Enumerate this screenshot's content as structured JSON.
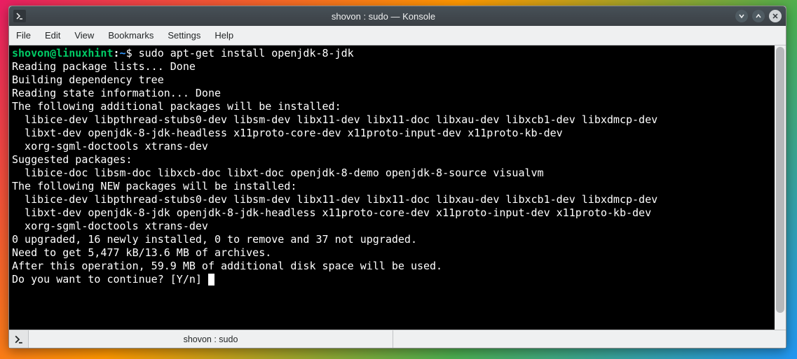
{
  "titlebar": {
    "title": "shovon : sudo — Konsole"
  },
  "menubar": {
    "file": "File",
    "edit": "Edit",
    "view": "View",
    "bookmarks": "Bookmarks",
    "settings": "Settings",
    "help": "Help"
  },
  "prompt": {
    "user_host": "shovon@linuxhint",
    "colon": ":",
    "path": "~",
    "dollar": "$",
    "command": " sudo apt-get install openjdk-8-jdk"
  },
  "output": {
    "l01": "Reading package lists... Done",
    "l02": "Building dependency tree       ",
    "l03": "Reading state information... Done",
    "l04": "The following additional packages will be installed:",
    "l05": "  libice-dev libpthread-stubs0-dev libsm-dev libx11-dev libx11-doc libxau-dev libxcb1-dev libxdmcp-dev",
    "l06": "  libxt-dev openjdk-8-jdk-headless x11proto-core-dev x11proto-input-dev x11proto-kb-dev",
    "l07": "  xorg-sgml-doctools xtrans-dev",
    "l08": "Suggested packages:",
    "l09": "  libice-doc libsm-doc libxcb-doc libxt-doc openjdk-8-demo openjdk-8-source visualvm",
    "l10": "The following NEW packages will be installed:",
    "l11": "  libice-dev libpthread-stubs0-dev libsm-dev libx11-dev libx11-doc libxau-dev libxcb1-dev libxdmcp-dev",
    "l12": "  libxt-dev openjdk-8-jdk openjdk-8-jdk-headless x11proto-core-dev x11proto-input-dev x11proto-kb-dev",
    "l13": "  xorg-sgml-doctools xtrans-dev",
    "l14": "0 upgraded, 16 newly installed, 0 to remove and 37 not upgraded.",
    "l15": "Need to get 5,477 kB/13.6 MB of archives.",
    "l16": "After this operation, 59.9 MB of additional disk space will be used.",
    "l17": "Do you want to continue? [Y/n] "
  },
  "tab": {
    "label": "shovon : sudo"
  }
}
